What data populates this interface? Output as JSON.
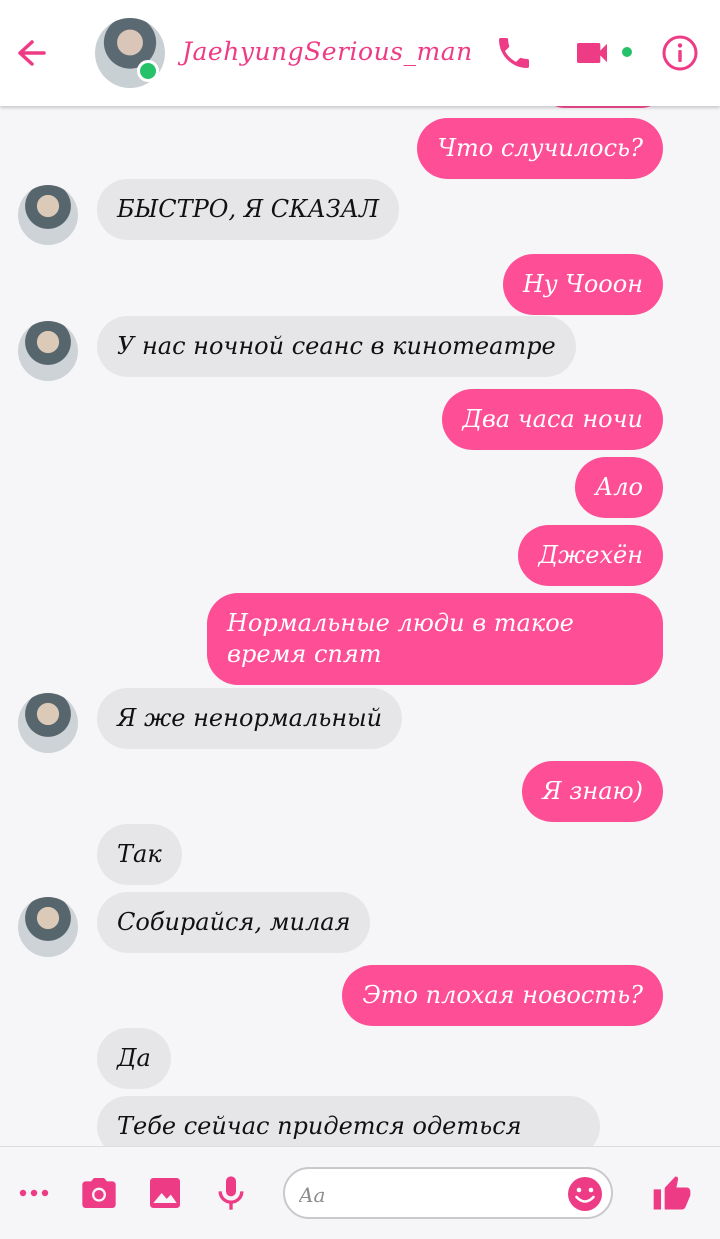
{
  "header": {
    "contact_name": "JaehyungSerious_man",
    "icons": [
      "back-arrow-icon",
      "phone-icon",
      "video-camera-icon",
      "info-icon"
    ]
  },
  "messages": [
    {
      "side": "out",
      "text": "Что случилось?"
    },
    {
      "side": "in",
      "text": "БЫСТРО, Я СКАЗАЛ"
    },
    {
      "side": "out",
      "text": "Ну Чооон"
    },
    {
      "side": "in",
      "text": "У нас ночной сеанс в кинотеатре"
    },
    {
      "side": "out",
      "text": "Два часа ночи"
    },
    {
      "side": "out",
      "text": "Ало"
    },
    {
      "side": "out",
      "text": "Джехён"
    },
    {
      "side": "out",
      "text": "Нормальные люди в такое время спят"
    },
    {
      "side": "in",
      "text": "Я же ненормальный"
    },
    {
      "side": "out",
      "text": "Я знаю)"
    },
    {
      "side": "in",
      "text": "Так"
    },
    {
      "side": "in",
      "text": "Собирайся, милая"
    },
    {
      "side": "out",
      "text": "Это плохая новость?"
    },
    {
      "side": "in",
      "text": "Да"
    },
    {
      "side": "in",
      "text": "Тебе сейчас придется одеться"
    }
  ],
  "composer": {
    "placeholder": "Aa",
    "icons": [
      "more-icon",
      "camera-icon",
      "image-icon",
      "microphone-icon",
      "emoji-icon",
      "like-icon"
    ]
  },
  "colors": {
    "accent": "#fd4e96",
    "online": "#25c26a",
    "incoming": "#e6e5e8"
  }
}
